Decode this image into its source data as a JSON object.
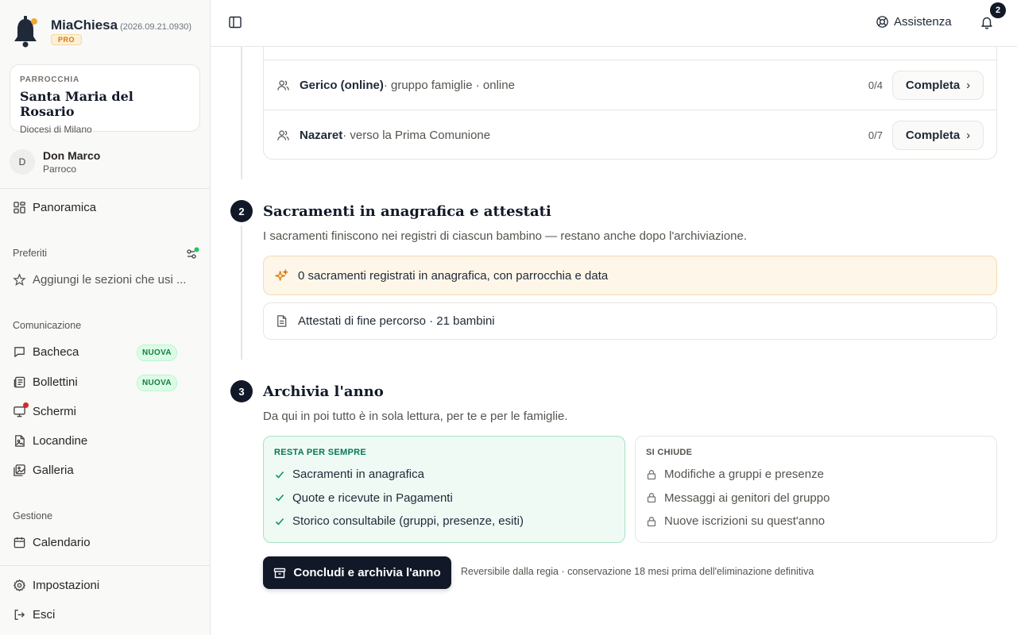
{
  "app": {
    "name": "MiaChiesa",
    "version": "(2026.09.21.0930)",
    "plan_badge": "PRO"
  },
  "parish": {
    "kicker": "PARROCCHIA",
    "name": "Santa Maria del Rosario",
    "diocese": "Diocesi di Milano"
  },
  "user": {
    "initial": "D",
    "name": "Don Marco",
    "role": "Parroco"
  },
  "sidebar": {
    "overview": "Panoramica",
    "favorites_label": "Preferiti",
    "favorites_placeholder": "Aggiungi le sezioni che usi ...",
    "communication_label": "Comunicazione",
    "communication_items": [
      {
        "label": "Bacheca",
        "badge": "NUOVA"
      },
      {
        "label": "Bollettini",
        "badge": "NUOVA"
      },
      {
        "label": "Schermi"
      },
      {
        "label": "Locandine"
      },
      {
        "label": "Galleria"
      }
    ],
    "management_label": "Gestione",
    "management_items": [
      {
        "label": "Calendario"
      }
    ],
    "settings": "Impostazioni",
    "logout": "Esci"
  },
  "topbar": {
    "assist_label": "Assistenza",
    "notification_count": "2"
  },
  "groups": [
    {
      "name": "Gerico (online)",
      "meta": " · gruppo famiglie · online",
      "count": "0/4",
      "action": "Completa"
    },
    {
      "name": "Nazaret",
      "meta": " · verso la Prima Comunione",
      "count": "0/7",
      "action": "Completa"
    }
  ],
  "step2": {
    "number": "2",
    "title": "Sacramenti in anagrafica e attestati",
    "description": "I sacramenti finiscono nei registri di ciascun bambino — restano anche dopo l'archiviazione.",
    "sacraments_note": "0 sacramenti registrati in anagrafica, con parrocchia e data",
    "certificates_note": "Attestati di fine percorso · 21 bambini"
  },
  "step3": {
    "number": "3",
    "title": "Archivia l'anno",
    "description": "Da qui in poi tutto è in sola lettura, per te e per le famiglie.",
    "keep": {
      "kicker": "RESTA PER SEMPRE",
      "items": [
        "Sacramenti in anagrafica",
        "Quote e ricevute in Pagamenti",
        "Storico consultabile (gruppi, presenze, esiti)"
      ]
    },
    "close": {
      "kicker": "SI CHIUDE",
      "items": [
        "Modifiche a gruppi e presenze",
        "Messaggi ai genitori del gruppo",
        "Nuove iscrizioni su quest'anno"
      ]
    },
    "archive_button": "Concludi e archivia l'anno",
    "archive_note": "Reversibile dalla regia · conservazione 18 mesi prima dell'eliminazione definitiva"
  },
  "colors": {
    "accent_dark": "#111827",
    "pro_badge": "#d97706",
    "new_badge": "#15803d",
    "keep_box": "#effaf4",
    "amber_box": "#fdf6e9",
    "alert_dot": "#dc2626",
    "online_dot": "#22c55e"
  }
}
